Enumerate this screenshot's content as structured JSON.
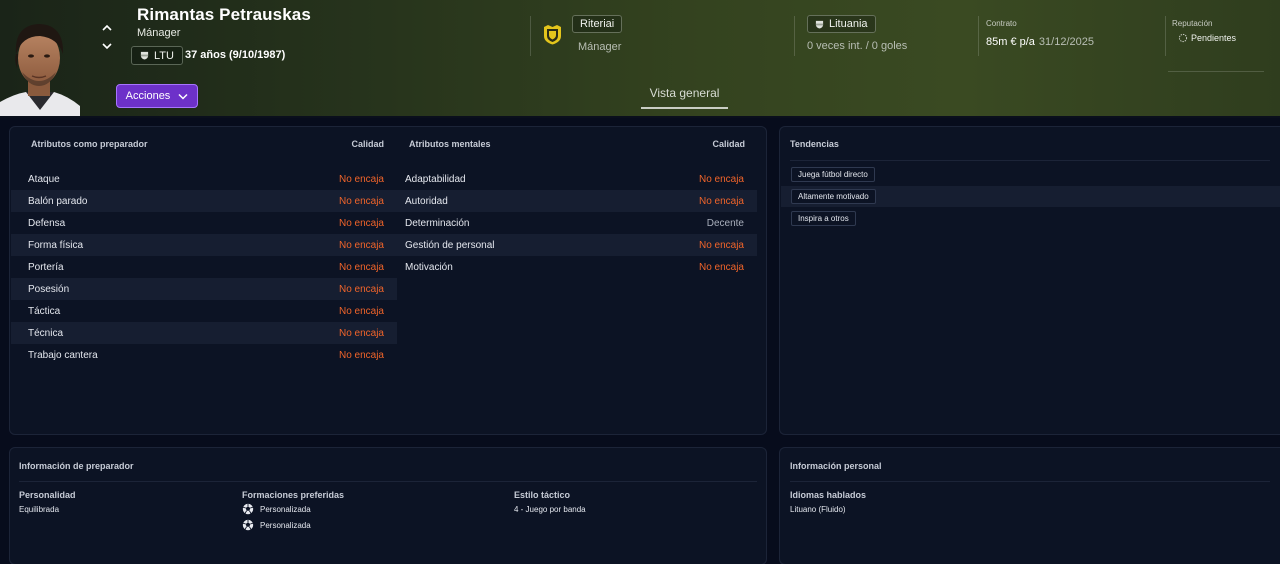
{
  "header": {
    "name": "Rimantas Petrauskas",
    "role": "Mánager",
    "nationality_code": "LTU",
    "age_dob": "37 años (9/10/1987)",
    "actions_label": "Acciones",
    "club": "Riteriai",
    "club_role": "Mánager",
    "country": "Lituania",
    "international": "0 veces int. / 0 goles",
    "contract_label": "Contrato",
    "contract_wage": "85m € p/a",
    "contract_end": "31/12/2025",
    "reputation_label": "Reputación",
    "reputation_value": "Pendientes",
    "tab": "Vista general"
  },
  "coaching": {
    "header": "Atributos como preparador",
    "quality_header": "Calidad",
    "rows": [
      {
        "name": "Ataque",
        "quality": "No encaja"
      },
      {
        "name": "Balón parado",
        "quality": "No encaja"
      },
      {
        "name": "Defensa",
        "quality": "No encaja"
      },
      {
        "name": "Forma física",
        "quality": "No encaja"
      },
      {
        "name": "Portería",
        "quality": "No encaja"
      },
      {
        "name": "Posesión",
        "quality": "No encaja"
      },
      {
        "name": "Táctica",
        "quality": "No encaja"
      },
      {
        "name": "Técnica",
        "quality": "No encaja"
      },
      {
        "name": "Trabajo cantera",
        "quality": "No encaja"
      }
    ]
  },
  "mental": {
    "header": "Atributos mentales",
    "quality_header": "Calidad",
    "rows": [
      {
        "name": "Adaptabilidad",
        "quality": "No encaja"
      },
      {
        "name": "Autoridad",
        "quality": "No encaja"
      },
      {
        "name": "Determinación",
        "quality": "Decente"
      },
      {
        "name": "Gestión de personal",
        "quality": "No encaja"
      },
      {
        "name": "Motivación",
        "quality": "No encaja"
      }
    ]
  },
  "tendencies": {
    "title": "Tendencias",
    "items": [
      "Juega fútbol directo",
      "Altamente motivado",
      "Inspira a otros"
    ]
  },
  "coach_info": {
    "title": "Información de preparador",
    "personality_label": "Personalidad",
    "personality": "Equilibrada",
    "formations_label": "Formaciones preferidas",
    "formations": [
      "Personalizada",
      "Personalizada"
    ],
    "style_label": "Estilo táctico",
    "style": "4 - Juego por banda"
  },
  "personal_info": {
    "title": "Información personal",
    "languages_label": "Idiomas hablados",
    "languages": "Lituano (Fluido)"
  },
  "colors": {
    "accent_purple": "#6d31c9",
    "warning_orange": "#f0642a"
  }
}
